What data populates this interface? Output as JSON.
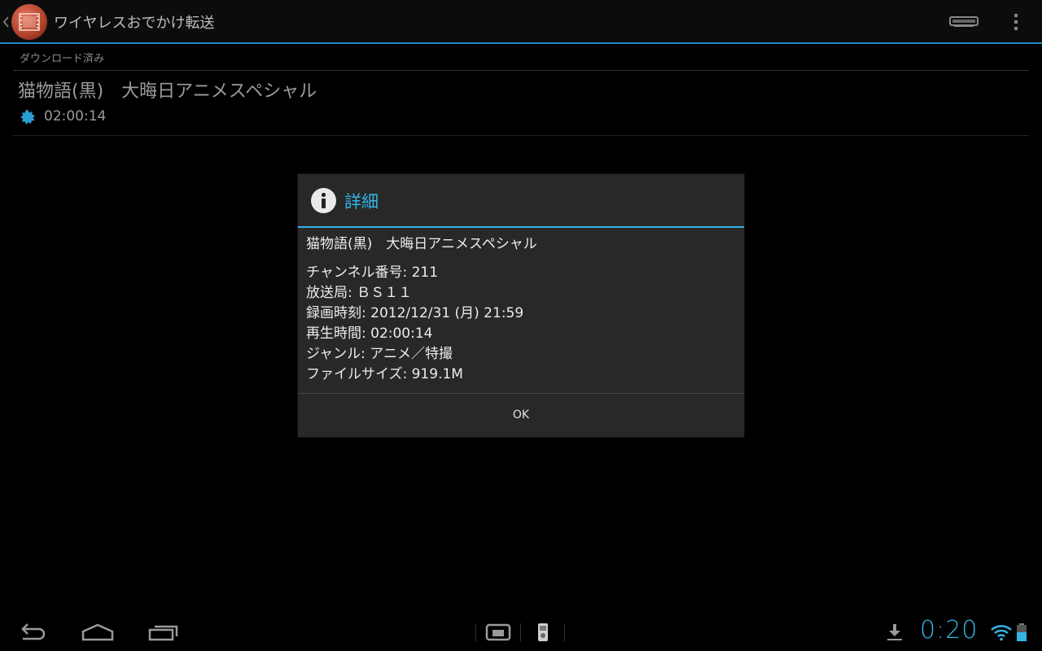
{
  "actionbar": {
    "title": "ワイヤレスおでかけ転送",
    "icons": [
      "back-chevron-icon",
      "film-icon",
      "device-icon",
      "overflow-menu-icon"
    ]
  },
  "list": {
    "section_header": "ダウンロード済み",
    "item": {
      "title": "猫物語(黒)　大晦日アニメスペシャル",
      "duration": "02:00:14",
      "icon": "badge-icon"
    }
  },
  "dialog": {
    "title": "詳細",
    "icon": "info-icon",
    "lines": [
      "猫物語(黒)　大晦日アニメスペシャル",
      "チャンネル番号: 211",
      "放送局: ＢＳ１１",
      "録画時刻: 2012/12/31 (月) 21:59",
      "再生時間: 02:00:14",
      "ジャンル: アニメ／特撮",
      "ファイルサイズ: 919.1M"
    ],
    "ok_label": "OK"
  },
  "statusbar": {
    "clock": "0:20",
    "icons": [
      "back-icon",
      "home-icon",
      "recent-apps-icon",
      "screen-icon",
      "phone-icon",
      "download-icon",
      "wifi-icon",
      "battery-icon"
    ]
  },
  "colors": {
    "accent": "#33b5e5",
    "background": "#000000",
    "dialog_bg": "#282828"
  }
}
